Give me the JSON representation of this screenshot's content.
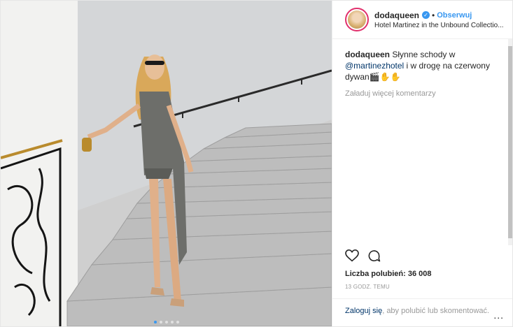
{
  "photo": {
    "carousel_dots": 5,
    "active_dot": 0
  },
  "header": {
    "username": "dodaqueen",
    "verified_icon": "verified-badge-icon",
    "separator": "•",
    "follow_label": "Obserwuj",
    "location": "Hotel Martinez in the Unbound Collectio..."
  },
  "caption": {
    "username": "dodaqueen",
    "text_before": " Słynne schody w ",
    "mention": "@martinezhotel",
    "text_after": " i w drogę na czerwony dywan🎬✋✋"
  },
  "load_more": "Załaduj więcej komentarzy",
  "actions": {
    "like_icon": "heart-icon",
    "comment_icon": "comment-icon"
  },
  "likes": "Liczba polubień: 36 008",
  "timestamp": "13 GODZ. TEMU",
  "footer": {
    "login_link": "Zaloguj się",
    "prompt": ", aby polubić lub skomentować.",
    "more_options": "..."
  },
  "colors": {
    "accent": "#3897f0",
    "link": "#003569",
    "muted": "#999999"
  }
}
